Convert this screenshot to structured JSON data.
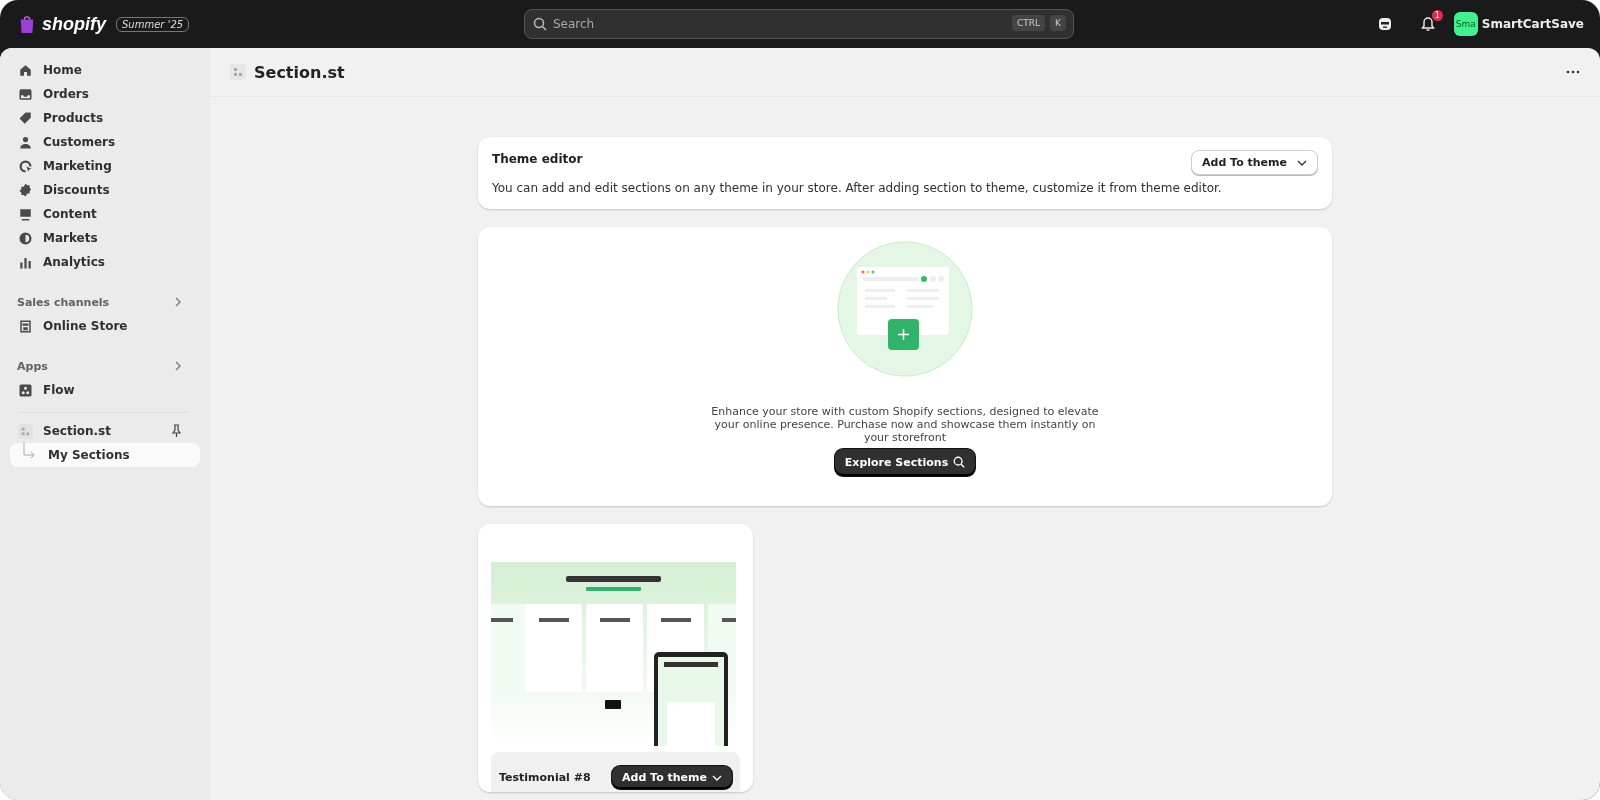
{
  "topbar": {
    "logo": "shopify",
    "badge": "Summer '25",
    "search": {
      "placeholder": "Search",
      "keys": [
        "CTRL",
        "K"
      ]
    },
    "notifications": "1",
    "avatar": "Sma",
    "store": "SmartCartSave"
  },
  "sidebar": {
    "items": [
      {
        "label": "Home",
        "selected": false
      },
      {
        "label": "Orders",
        "selected": false
      },
      {
        "label": "Products",
        "selected": false
      },
      {
        "label": "Customers",
        "selected": false
      },
      {
        "label": "Marketing",
        "selected": false
      },
      {
        "label": "Discounts",
        "selected": false
      },
      {
        "label": "Content",
        "selected": false
      },
      {
        "label": "Markets",
        "selected": false
      },
      {
        "label": "Analytics",
        "selected": false
      }
    ],
    "groups": [
      {
        "title": "Sales channels",
        "items": [
          {
            "label": "Online Store",
            "selected": false
          }
        ]
      },
      {
        "title": "Apps",
        "items": [
          {
            "label": "Flow",
            "selected": false
          }
        ]
      }
    ],
    "app": {
      "label": "Section.st",
      "children": [
        {
          "label": "My Sections",
          "selected": true
        }
      ]
    }
  },
  "page": {
    "title": "Section.st"
  },
  "theme_card": {
    "title": "Theme editor",
    "text": "You can add and edit sections on any theme in your store. After adding section to theme, customize it from theme editor.",
    "button": "Add To theme"
  },
  "explore_card": {
    "text": "Enhance your store with custom Shopify sections, designed to elevate your online presence. Purchase now and showcase them instantly on your storefront",
    "button": "Explore Sections"
  },
  "sections": [
    {
      "name": "Testimonial #8",
      "button": "Add To theme"
    }
  ]
}
